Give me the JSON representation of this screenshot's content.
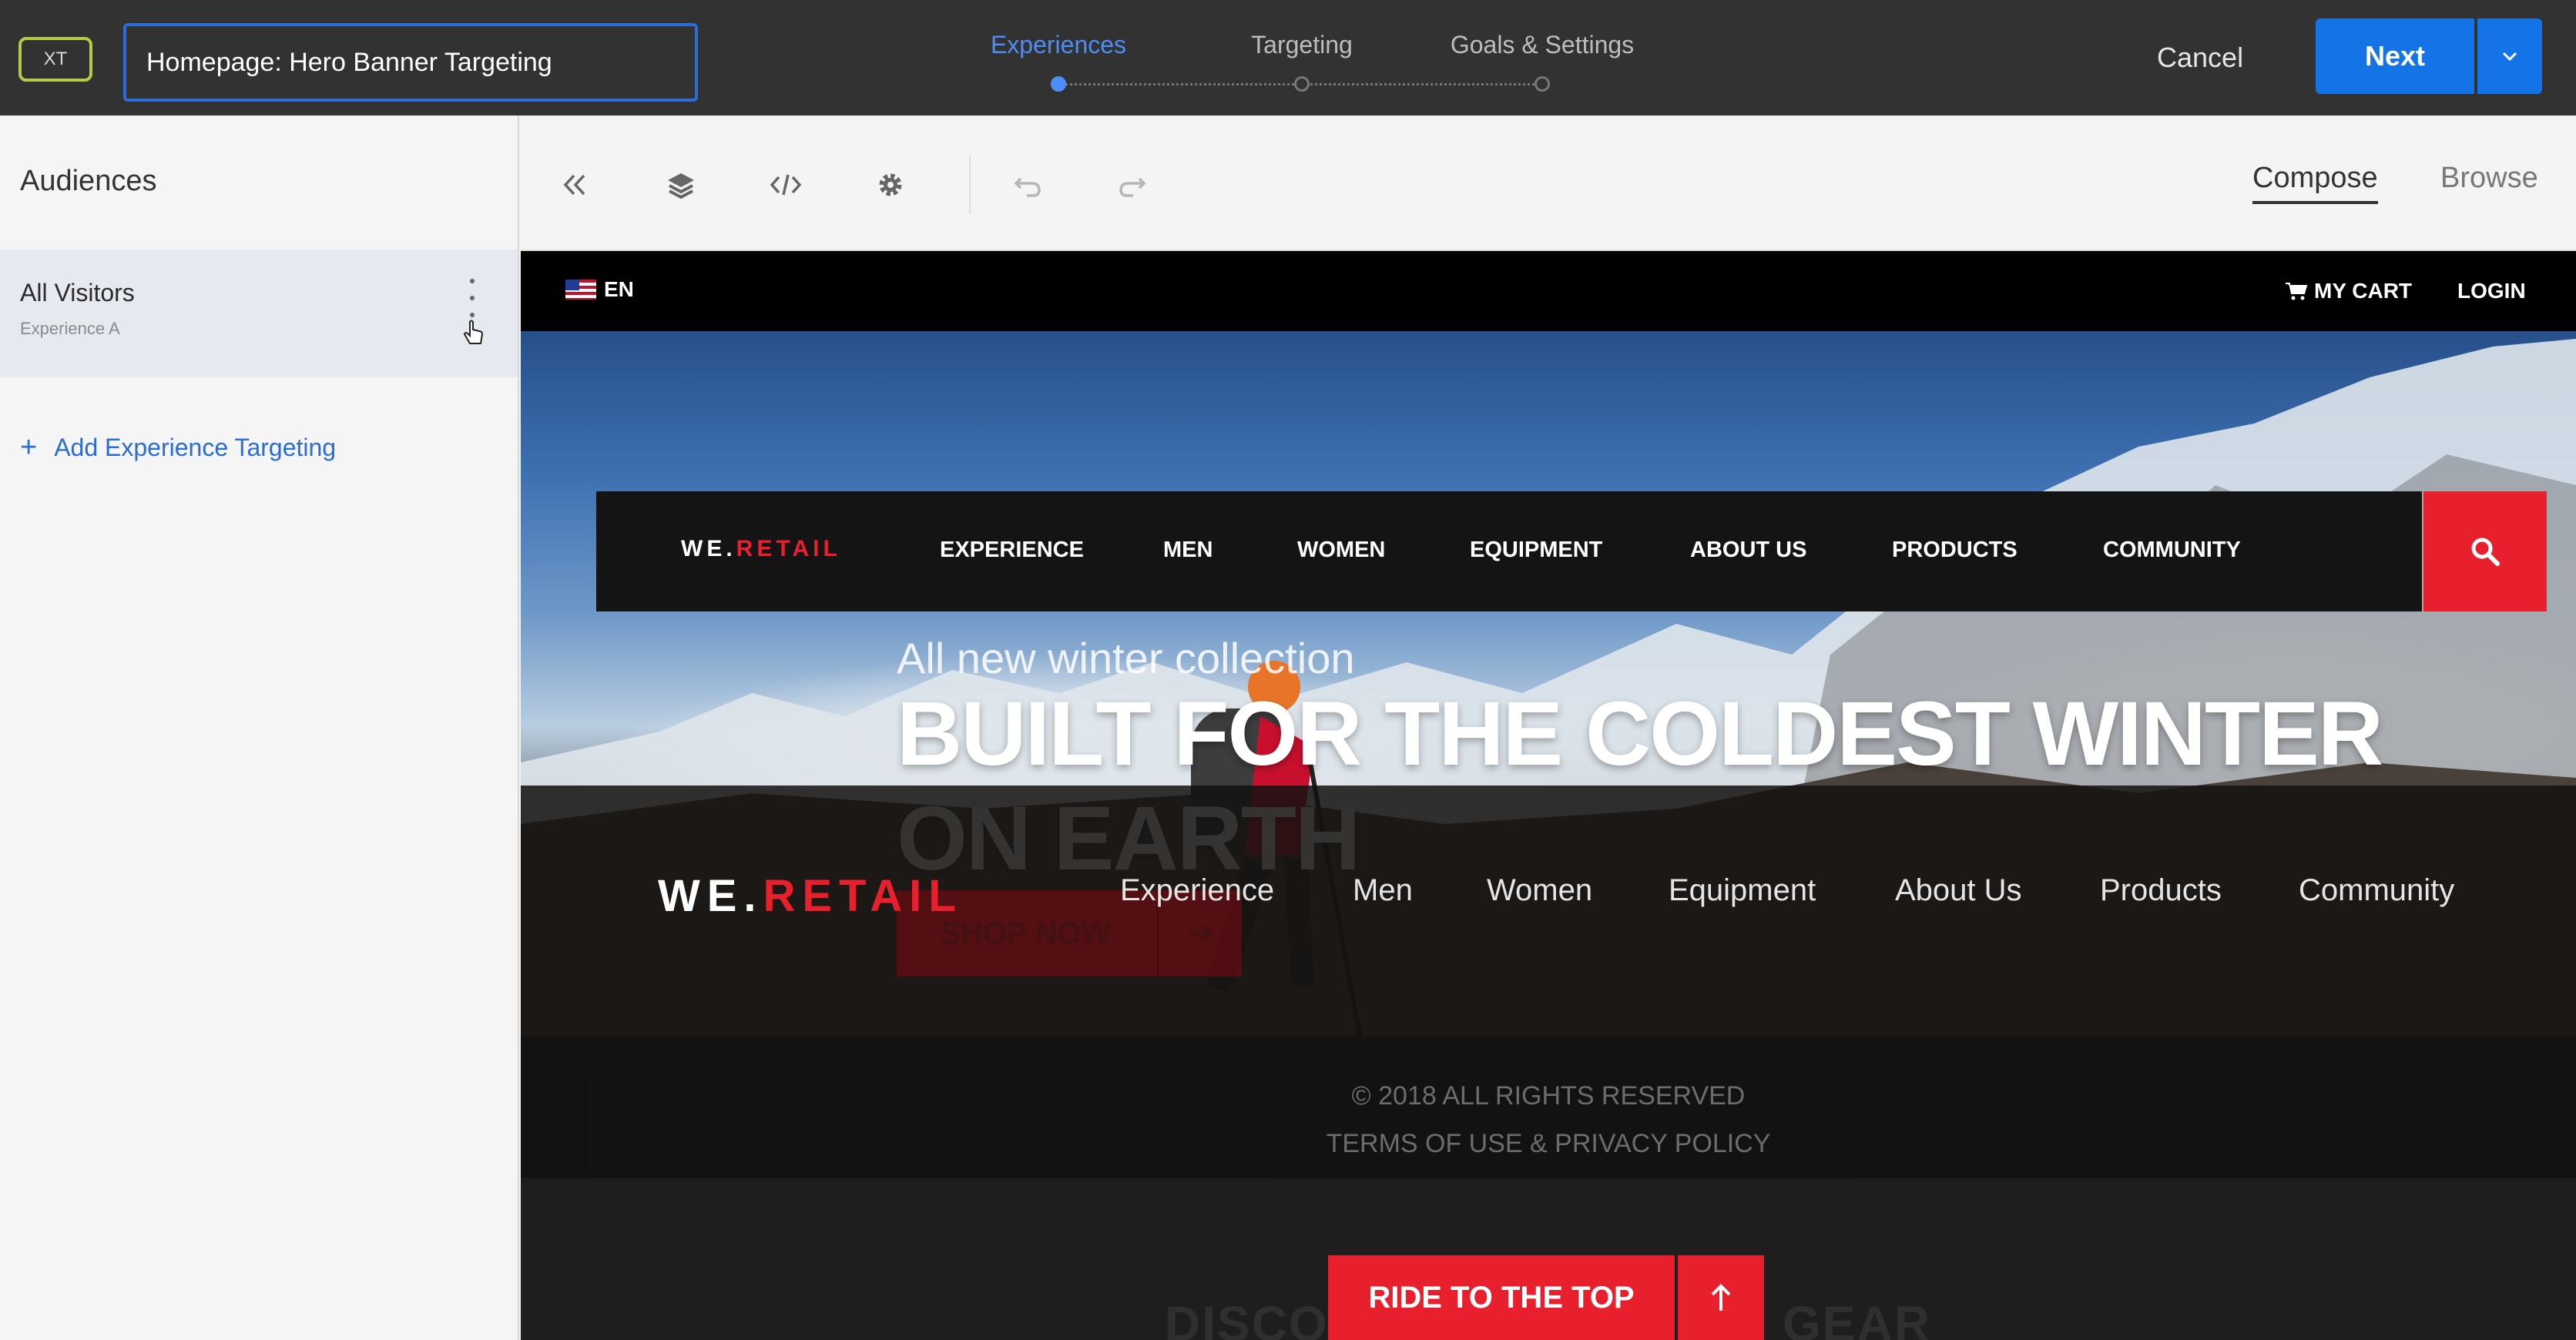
{
  "topbar": {
    "badge": "XT",
    "activity_name": "Homepage: Hero Banner Targeting",
    "steps": [
      {
        "label": "Experiences",
        "active": true
      },
      {
        "label": "Targeting",
        "active": false
      },
      {
        "label": "Goals & Settings",
        "active": false
      }
    ],
    "cancel_label": "Cancel",
    "next_label": "Next"
  },
  "sidebar": {
    "title": "Audiences",
    "audiences": [
      {
        "name": "All Visitors",
        "experience": "Experience A"
      }
    ],
    "add_label": "Add Experience Targeting",
    "add_icon": "+"
  },
  "toolbar": {
    "tools": [
      "collapse-icon",
      "layers-icon",
      "code-icon",
      "settings-icon",
      "undo-icon",
      "redo-icon"
    ],
    "modes": [
      {
        "label": "Compose",
        "active": true
      },
      {
        "label": "Browse",
        "active": false
      }
    ]
  },
  "site": {
    "utility": {
      "language": "EN",
      "cart": "MY CART",
      "login": "LOGIN"
    },
    "nav": {
      "logo_a": "WE.",
      "logo_b": "RETAIL",
      "links": [
        "EXPERIENCE",
        "MEN",
        "WOMEN",
        "EQUIPMENT",
        "ABOUT US",
        "PRODUCTS",
        "COMMUNITY"
      ]
    },
    "hero": {
      "subtitle": "All new winter collection",
      "headline": "BUILT FOR THE COLDEST WINTER ON EARTH",
      "cta": "SHOP NOW"
    },
    "footer": {
      "logo_a": "WE.",
      "logo_b": "RETAIL",
      "links": [
        "Experience",
        "Men",
        "Women",
        "Equipment",
        "About Us",
        "Products",
        "Community"
      ],
      "copyright": "© 2018 ALL RIGHTS RESERVED",
      "terms": "TERMS OF USE & PRIVACY POLICY"
    },
    "section": {
      "heading_left": "DISCO",
      "heading_right": "GEAR",
      "ride_label": "RIDE TO THE TOP"
    }
  },
  "colors": {
    "accent_blue": "#1473e6",
    "brand_red": "#e8202e",
    "active_step": "#4c8ef5"
  }
}
